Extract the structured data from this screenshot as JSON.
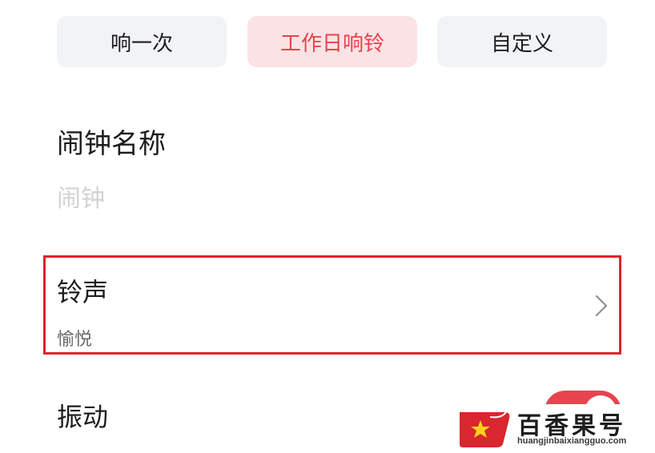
{
  "repeat_options": [
    {
      "label": "响一次",
      "selected": false
    },
    {
      "label": "工作日响铃",
      "selected": true
    },
    {
      "label": "自定义",
      "selected": false
    }
  ],
  "alarm_name": {
    "title": "闹钟名称",
    "placeholder": "闹钟",
    "value": ""
  },
  "ringtone": {
    "title": "铃声",
    "value": "愉悦"
  },
  "vibration": {
    "title": "振动",
    "enabled": true
  },
  "watermark": {
    "name": "百香果号",
    "domain": "huangjinbaixiangguo.com"
  },
  "colors": {
    "accent": "#e8434e",
    "selected_bg": "#fbe3e5",
    "highlight_border": "#d9262f"
  },
  "icons": {
    "ringtone_chevron": "chevron-right-icon",
    "watermark_logo": "star-logo-icon"
  }
}
